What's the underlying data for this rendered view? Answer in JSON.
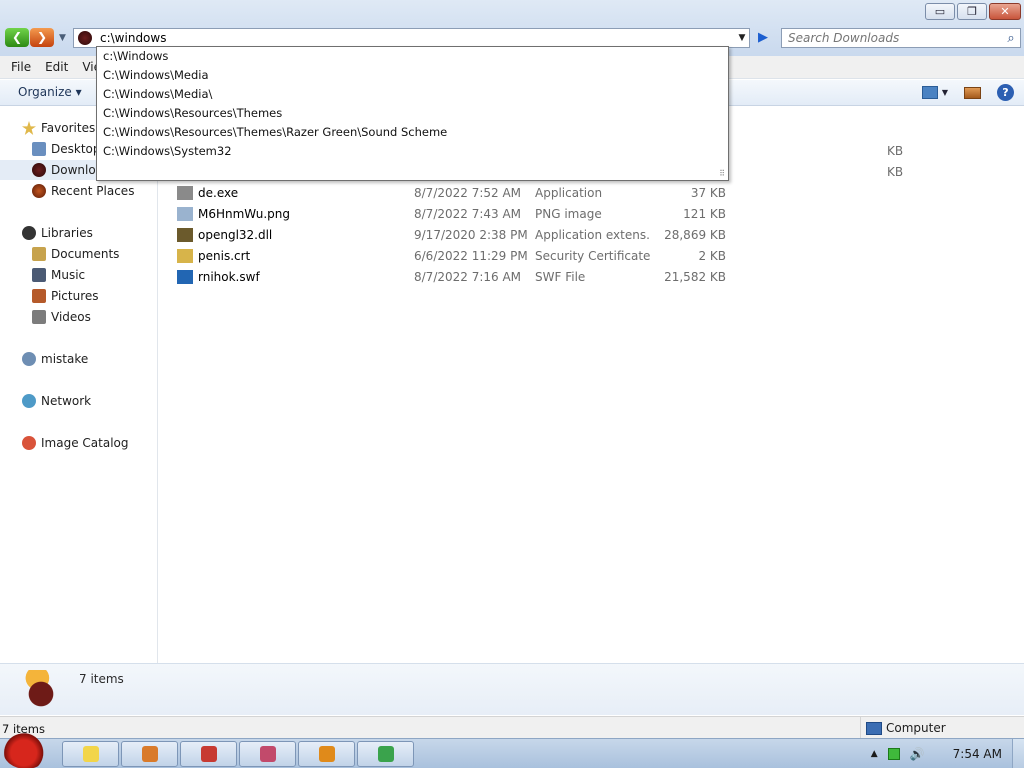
{
  "window": {
    "minimize_glyph": "▭",
    "restore_glyph": "❐",
    "close_glyph": "✕"
  },
  "navigation": {
    "back_glyph": "❮",
    "forward_glyph": "❯",
    "history_glyph": "▼"
  },
  "address": {
    "value": "c:\\windows",
    "dropdown_glyph": "▼",
    "go_glyph": "▶"
  },
  "search": {
    "placeholder": "Search Downloads",
    "icon_glyph": "⌕"
  },
  "menubar": {
    "items": [
      "File",
      "Edit",
      "Vie"
    ]
  },
  "command_bar": {
    "organize_label": "Organize ▾",
    "help_glyph": "?",
    "views_drop_glyph": "▼"
  },
  "autocomplete": {
    "items": [
      "c:\\Windows",
      "C:\\Windows\\Media",
      "C:\\Windows\\Media\\",
      "C:\\Windows\\Resources\\Themes",
      "C:\\Windows\\Resources\\Themes\\Razer Green\\Sound Scheme",
      "C:\\Windows\\System32"
    ],
    "grip_glyph": "⠿"
  },
  "nav_pane": {
    "favorites": "Favorites",
    "favorites_items": [
      "Desktop",
      "Downloa",
      "Recent Places"
    ],
    "libraries": "Libraries",
    "libraries_items": [
      "Documents",
      "Music",
      "Pictures",
      "Videos"
    ],
    "homegroup": "mistake",
    "network": "Network",
    "catalog": "Image Catalog"
  },
  "files": {
    "rows": [
      {
        "name": "de.exe",
        "date": "8/7/2022 7:52 AM",
        "type": "Application",
        "size": "37 KB",
        "icon": "exe-icon",
        "color": "#8a8a8a"
      },
      {
        "name": "M6HnmWu.png",
        "date": "8/7/2022 7:43 AM",
        "type": "PNG image",
        "size": "121 KB",
        "icon": "png-icon",
        "color": "#9ab3cf"
      },
      {
        "name": "opengl32.dll",
        "date": "9/17/2020 2:38 PM",
        "type": "Application extens...",
        "size": "28,869 KB",
        "icon": "dll-icon",
        "color": "#6b5a2c"
      },
      {
        "name": "penis.crt",
        "date": "6/6/2022 11:29 PM",
        "type": "Security Certificate",
        "size": "2 KB",
        "icon": "certificate-icon",
        "color": "#d7b44a"
      },
      {
        "name": "rnihok.swf",
        "date": "8/7/2022 7:16 AM",
        "type": "SWF File",
        "size": "21,582 KB",
        "icon": "swf-icon",
        "color": "#2266b3"
      }
    ],
    "hidden_sizes": [
      "KB",
      "KB"
    ]
  },
  "details": {
    "count": "7 items"
  },
  "statusbar": {
    "left": "7 items",
    "right": "Computer"
  },
  "taskbar": {
    "clock": "7:54 AM",
    "tray_up_glyph": "▲",
    "volume_glyph": "🔊",
    "buttons": [
      {
        "name": "explorer-taskbar-button",
        "color": "#f2d54a"
      },
      {
        "name": "paint-taskbar-button",
        "color": "#d97a2a"
      },
      {
        "name": "app-taskbar-button",
        "color": "#c73a32"
      },
      {
        "name": "tool-taskbar-button",
        "color": "#c24a6b"
      },
      {
        "name": "search-taskbar-button",
        "color": "#e08a1a"
      },
      {
        "name": "chrome-taskbar-button",
        "color": "#3aa34c"
      }
    ]
  }
}
